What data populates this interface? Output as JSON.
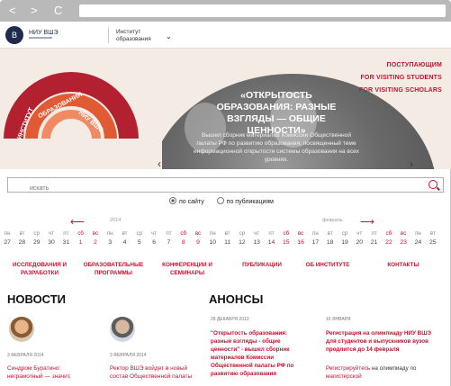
{
  "browser": {
    "back": "<",
    "forward": ">",
    "reload": "C"
  },
  "header": {
    "logo_text": "В",
    "brand": "НИУ ВШЭ",
    "institute": "Институт образования",
    "chevron": "⌄"
  },
  "hero": {
    "arc_labels": [
      "ИНСТИТУТ",
      "ОБРАЗОВАНИЯ",
      "НИУ ВШЭ"
    ],
    "title": "«ОТКРЫТОСТЬ ОБРАЗОВАНИЯ: РАЗНЫЕ ВЗГЛЯДЫ — ОБЩИЕ ЦЕННОСТИ»",
    "description": "Вышел сборник материалов Комиссии Общественной палаты РФ по развитию образования, посвященный теме информационной открытости системы образования на всех уровнях.",
    "prev": "‹",
    "next": "›",
    "quick_links": [
      "ПОСТУПАЮЩИМ",
      "FOR VISITING STUDENTS",
      "FOR VISITING SCHOLARS"
    ]
  },
  "search": {
    "placeholder": "искать",
    "options": [
      "по сайту",
      "по публикациям"
    ],
    "selected": "по сайту"
  },
  "calendar": {
    "year_label": "2014",
    "month_label": "февраль",
    "weekdays": [
      "пн",
      "вт",
      "ср",
      "чт",
      "пт",
      "сб",
      "вс",
      "пн",
      "вт",
      "ср",
      "чт",
      "пт",
      "сб",
      "вс",
      "пн",
      "вт",
      "ср",
      "чт",
      "пт",
      "сб",
      "вс",
      "пн",
      "вт",
      "ср",
      "чт",
      "пт",
      "сб",
      "вс",
      "пн",
      "вт"
    ],
    "days": [
      "27",
      "28",
      "29",
      "30",
      "31",
      "1",
      "2",
      "3",
      "4",
      "5",
      "6",
      "7",
      "8",
      "9",
      "10",
      "11",
      "12",
      "13",
      "14",
      "15",
      "16",
      "17",
      "18",
      "19",
      "20",
      "21",
      "22",
      "23",
      "24",
      "25"
    ],
    "weekend_indices": [
      5,
      6,
      12,
      13,
      19,
      20,
      26,
      27
    ]
  },
  "menu": [
    "ИССЛЕДОВАНИЯ И РАЗРАБОТКИ",
    "ОБРАЗОВАТЕЛЬНЫЕ ПРОГРАММЫ",
    "КОНФЕРЕНЦИИ И СЕМИНАРЫ",
    "ПУБЛИКАЦИИ",
    "ОБ ИНСТИТУТЕ",
    "КОНТАКТЫ"
  ],
  "news": {
    "heading": "НОВОСТИ",
    "items": [
      {
        "date": "3 ФЕВРАЛЯ 2014",
        "title": "Синдром Буратино: неграмотный — значит,"
      },
      {
        "date": "3 ФЕВРАЛЯ 2014",
        "title": "Ректор ВШЭ войдет в новый состав Общественной палаты"
      }
    ]
  },
  "announcements": {
    "heading": "АНОНСЫ",
    "items": [
      {
        "date": "28 ДЕКАБРЯ 2013",
        "title": "\"Открытость образования: разные взгляды - общие ценности\" - вышел сборник материалов Комиссии Общественной палаты РФ по развитию образования"
      },
      {
        "date": "15 ЯНВАРЯ",
        "title": "Регистрация на олимпиаду НИУ ВШЭ для студентов и выпускников вузов продлится до 14 февраля",
        "text_red": "Регистрируйтесь",
        "text": " на олимпиаду по ",
        "text_red2": "магистерской"
      }
    ]
  },
  "colors": {
    "accent": "#c8102e",
    "hero_bg": "#f4ebe4"
  }
}
